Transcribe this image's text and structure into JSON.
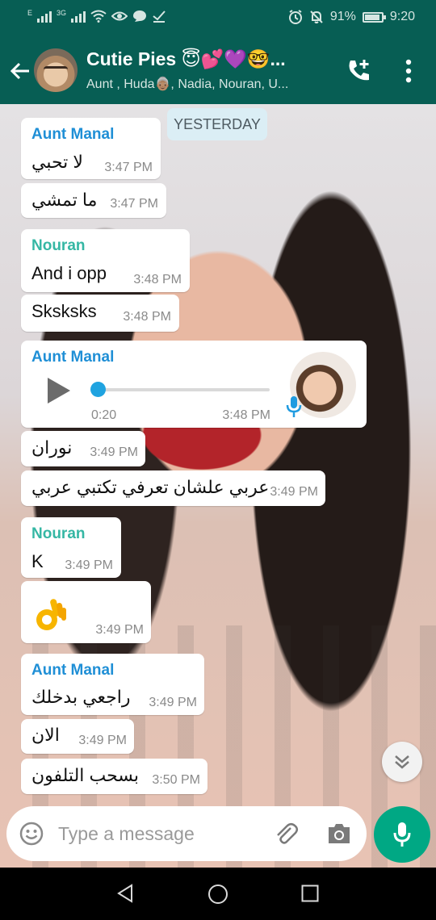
{
  "status_bar": {
    "left_small": "E",
    "network": "3G",
    "battery": "91%",
    "battery_level": 0.91,
    "time": "9:20"
  },
  "header": {
    "title": "Cutie Pies 😇💕💜🤓...",
    "subtitle": "Aunt , Huda👵🏽, Nadia, Nouran, U..."
  },
  "chat": {
    "date_chip": "YESTERDAY",
    "colors": {
      "aunt_manal": "#1f8fd6",
      "nouran": "#35b7a4",
      "bubble": "#ffffff",
      "accent": "#00a884"
    },
    "messages": [
      {
        "sender": "Aunt Manal",
        "text": "لا تحبي",
        "time": "3:47 PM"
      },
      {
        "text": "ما تمشي",
        "time": "3:47 PM"
      },
      {
        "sender": "Nouran",
        "text": "And i opp",
        "time": "3:48 PM"
      },
      {
        "text": "Sksksks",
        "time": "3:48 PM"
      },
      {
        "sender": "Aunt Manal",
        "type": "voice",
        "duration": "0:20",
        "progress": 0.0,
        "time": "3:48 PM"
      },
      {
        "text": "نوران",
        "time": "3:49 PM"
      },
      {
        "text": "عربي علشان تعرفي تكتبي عربي",
        "time": "3:49 PM"
      },
      {
        "sender": "Nouran",
        "text": "K",
        "time": "3:49 PM"
      },
      {
        "type": "emoji",
        "emoji": "ok-hand-emoji",
        "time": "3:49 PM"
      },
      {
        "sender": "Aunt Manal",
        "text": "راجعي بدخلك",
        "time": "3:49 PM"
      },
      {
        "text": "الان",
        "time": "3:49 PM"
      },
      {
        "text": "بسحب التلفون",
        "time": "3:50 PM"
      }
    ]
  },
  "input": {
    "placeholder": "Type a message"
  },
  "icons": {
    "back": "arrow-left-icon",
    "add_call": "add-call-icon",
    "menu": "more-vert-icon",
    "emoji": "emoji-icon",
    "attach": "paperclip-icon",
    "camera": "camera-icon",
    "mic": "mic-icon",
    "scroll": "chevron-double-down-icon"
  }
}
